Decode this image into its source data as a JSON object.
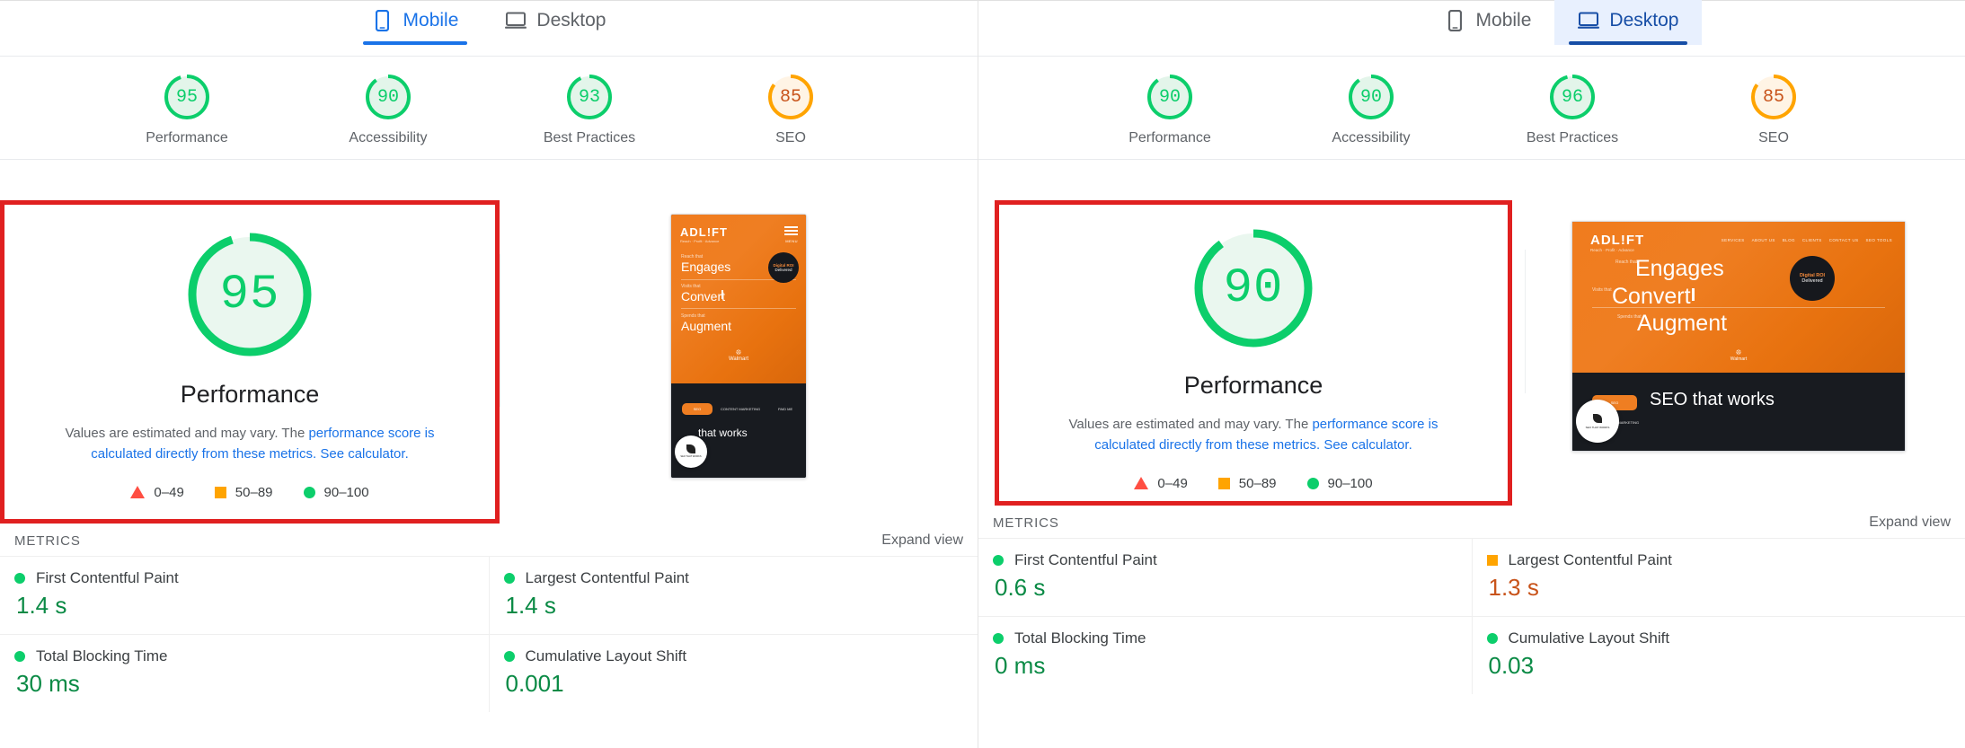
{
  "colors": {
    "green": "#0cce6b",
    "green_text": "#0a8a45",
    "orange": "#ffa400",
    "orange_text": "#c8531a",
    "red": "#ff4e42",
    "blue": "#1a73e8",
    "blue_active": "#174ea6",
    "highlight_box": "#e02020",
    "ring_track_green": "#e3f5ea",
    "ring_track_orange": "#fff4e5"
  },
  "panels": [
    {
      "id": "mobile-panel",
      "tabs": [
        {
          "label": "Mobile",
          "icon": "mobile-phone-icon",
          "active": true,
          "hovered": false
        },
        {
          "label": "Desktop",
          "icon": "desktop-monitor-icon",
          "active": false,
          "hovered": false
        }
      ],
      "scores": [
        {
          "label": "Performance",
          "value": "95",
          "pct": 95,
          "status": "green"
        },
        {
          "label": "Accessibility",
          "value": "90",
          "pct": 90,
          "status": "green"
        },
        {
          "label": "Best Practices",
          "value": "93",
          "pct": 93,
          "status": "green"
        },
        {
          "label": "SEO",
          "value": "85",
          "pct": 85,
          "status": "orange"
        }
      ],
      "performance_card": {
        "score": "95",
        "pct": 95,
        "title": "Performance",
        "desc_before": "Values are estimated and may vary. The ",
        "desc_link1": "performance score is calculated directly from these metrics.",
        "desc_link2": "See calculator.",
        "legend": [
          {
            "shape": "triangle",
            "label": "0–49"
          },
          {
            "shape": "square",
            "label": "50–89"
          },
          {
            "shape": "circle",
            "label": "90–100"
          }
        ]
      },
      "thumbnail": {
        "form_factor": "mobile",
        "logo": "ADL!FT",
        "logo_sub": "Reach · Profit · Advance",
        "menu_label": "MENU",
        "kicker1": "Reach that",
        "headline1": "Engages",
        "kicker2": "Visits that",
        "headline2": "Convert",
        "kicker3": "Spends that",
        "headline3": "Augment",
        "badge_line1": "Digital ROI",
        "badge_line2": "Delivered",
        "client": "Walmart",
        "tabs": [
          "SEO",
          "CONTENT MARKETING",
          "PAID ME"
        ],
        "dark_headline": "that works",
        "fab": "SEO THAT WORKS"
      },
      "metrics_header": {
        "title": "METRICS",
        "expand": "Expand view"
      },
      "metrics": [
        [
          {
            "name": "First Contentful Paint",
            "value": "1.4 s",
            "status": "green"
          },
          {
            "name": "Total Blocking Time",
            "value": "30 ms",
            "status": "green"
          }
        ],
        [
          {
            "name": "Largest Contentful Paint",
            "value": "1.4 s",
            "status": "green"
          },
          {
            "name": "Cumulative Layout Shift",
            "value": "0.001",
            "status": "green"
          }
        ]
      ]
    },
    {
      "id": "desktop-panel",
      "tabs": [
        {
          "label": "Mobile",
          "icon": "mobile-phone-icon",
          "active": false,
          "hovered": false
        },
        {
          "label": "Desktop",
          "icon": "desktop-monitor-icon",
          "active": true,
          "hovered": true
        }
      ],
      "scores": [
        {
          "label": "Performance",
          "value": "90",
          "pct": 90,
          "status": "green"
        },
        {
          "label": "Accessibility",
          "value": "90",
          "pct": 90,
          "status": "green"
        },
        {
          "label": "Best Practices",
          "value": "96",
          "pct": 96,
          "status": "green"
        },
        {
          "label": "SEO",
          "value": "85",
          "pct": 85,
          "status": "orange"
        }
      ],
      "performance_card": {
        "score": "90",
        "pct": 90,
        "title": "Performance",
        "desc_before": "Values are estimated and may vary. The ",
        "desc_link1": "performance score is calculated directly from these metrics.",
        "desc_link2": "See calculator.",
        "legend": [
          {
            "shape": "triangle",
            "label": "0–49"
          },
          {
            "shape": "square",
            "label": "50–89"
          },
          {
            "shape": "circle",
            "label": "90–100"
          }
        ]
      },
      "thumbnail": {
        "form_factor": "desktop",
        "logo": "ADL!FT",
        "logo_sub": "Reach · Profit · Advance",
        "menu_label": "",
        "nav": [
          "SERVICES",
          "ABOUT US",
          "BLOG",
          "CLIENTS",
          "CONTACT US",
          "SEO TOOLS"
        ],
        "kicker1": "Reach that",
        "headline1": "Engages",
        "kicker2": "Visits that",
        "headline2": "Convert",
        "kicker3": "Spends that",
        "headline3": "Augment",
        "badge_line1": "Digital ROI",
        "badge_line2": "Delivered",
        "client": "Walmart",
        "tabs": [
          "SEO",
          "CONTENT MARKETING"
        ],
        "dark_headline": "SEO that works",
        "fab": "SEO THAT WORKS"
      },
      "metrics_header": {
        "title": "METRICS",
        "expand": "Expand view"
      },
      "metrics": [
        [
          {
            "name": "First Contentful Paint",
            "value": "0.6 s",
            "status": "green"
          },
          {
            "name": "Total Blocking Time",
            "value": "0 ms",
            "status": "green"
          }
        ],
        [
          {
            "name": "Largest Contentful Paint",
            "value": "1.3 s",
            "status": "orange"
          },
          {
            "name": "Cumulative Layout Shift",
            "value": "0.03",
            "status": "green"
          }
        ]
      ]
    }
  ]
}
